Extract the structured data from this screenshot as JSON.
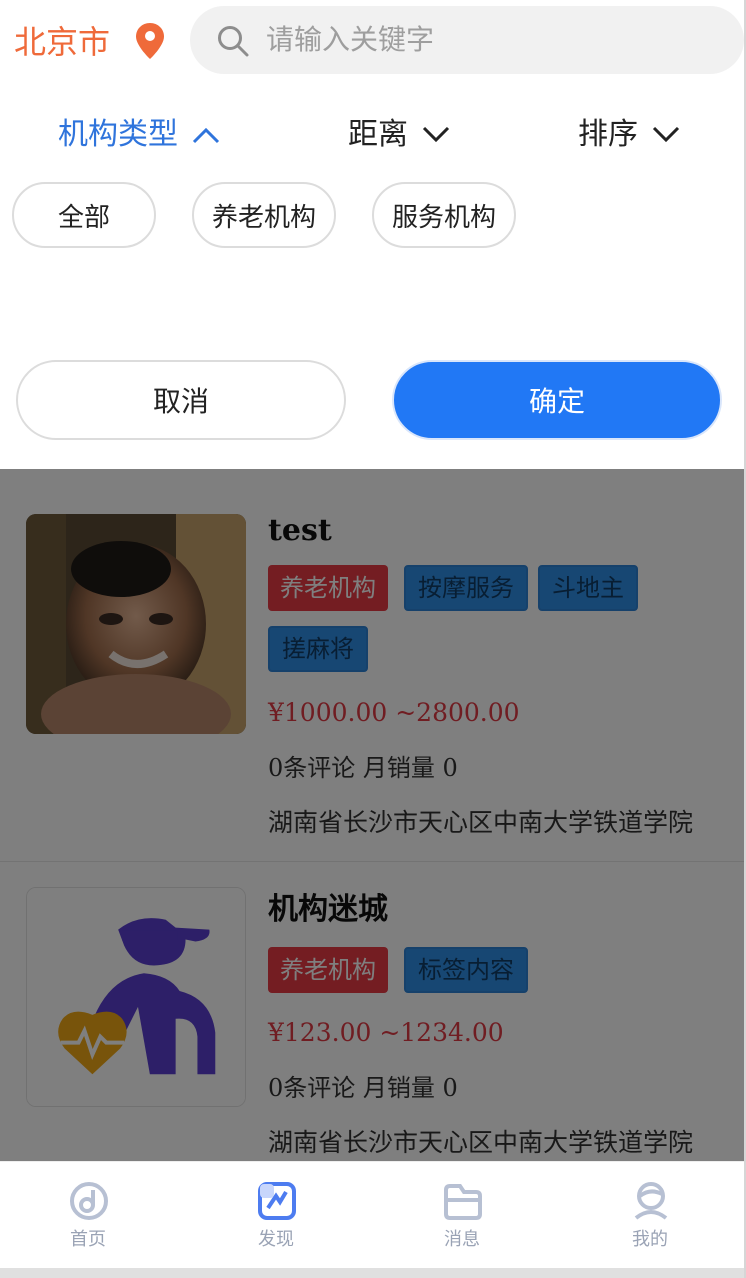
{
  "header": {
    "city": "北京市",
    "search_placeholder": "请输入关键字"
  },
  "filter_tabs": [
    {
      "label": "机构类型",
      "active": true
    },
    {
      "label": "距离",
      "active": false
    },
    {
      "label": "排序",
      "active": false
    }
  ],
  "chips": [
    "全部",
    "养老机构",
    "服务机构"
  ],
  "actions": {
    "cancel": "取消",
    "confirm": "确定"
  },
  "listings": [
    {
      "name": "test",
      "tags": [
        {
          "text": "养老机构",
          "color": "red"
        },
        {
          "text": "按摩服务",
          "color": "blue"
        },
        {
          "text": "斗地主",
          "color": "blue"
        },
        {
          "text": "搓麻将",
          "color": "blue"
        }
      ],
      "price": "¥1000.00 ~2800.00",
      "stats": "0条评论 月销量 0",
      "address": "湖南省长沙市天心区中南大学铁道学院"
    },
    {
      "name": "机构迷城",
      "tags": [
        {
          "text": "养老机构",
          "color": "red"
        },
        {
          "text": "标签内容",
          "color": "blue"
        }
      ],
      "price": "¥123.00 ~1234.00",
      "stats": "0条评论 月销量 0",
      "address": "湖南省长沙市天心区中南大学铁道学院"
    }
  ],
  "tabbar": [
    {
      "label": "首页",
      "icon": "home-icon",
      "active": false
    },
    {
      "label": "发现",
      "icon": "discover-icon",
      "active": true
    },
    {
      "label": "消息",
      "icon": "message-icon",
      "active": false
    },
    {
      "label": "我的",
      "icon": "profile-icon",
      "active": false
    }
  ],
  "colors": {
    "accent": "#2178f5",
    "city": "#ef6a3a",
    "price": "#e03a45",
    "tag_red": "#e83a45",
    "tag_blue": "#2f8fe6"
  }
}
